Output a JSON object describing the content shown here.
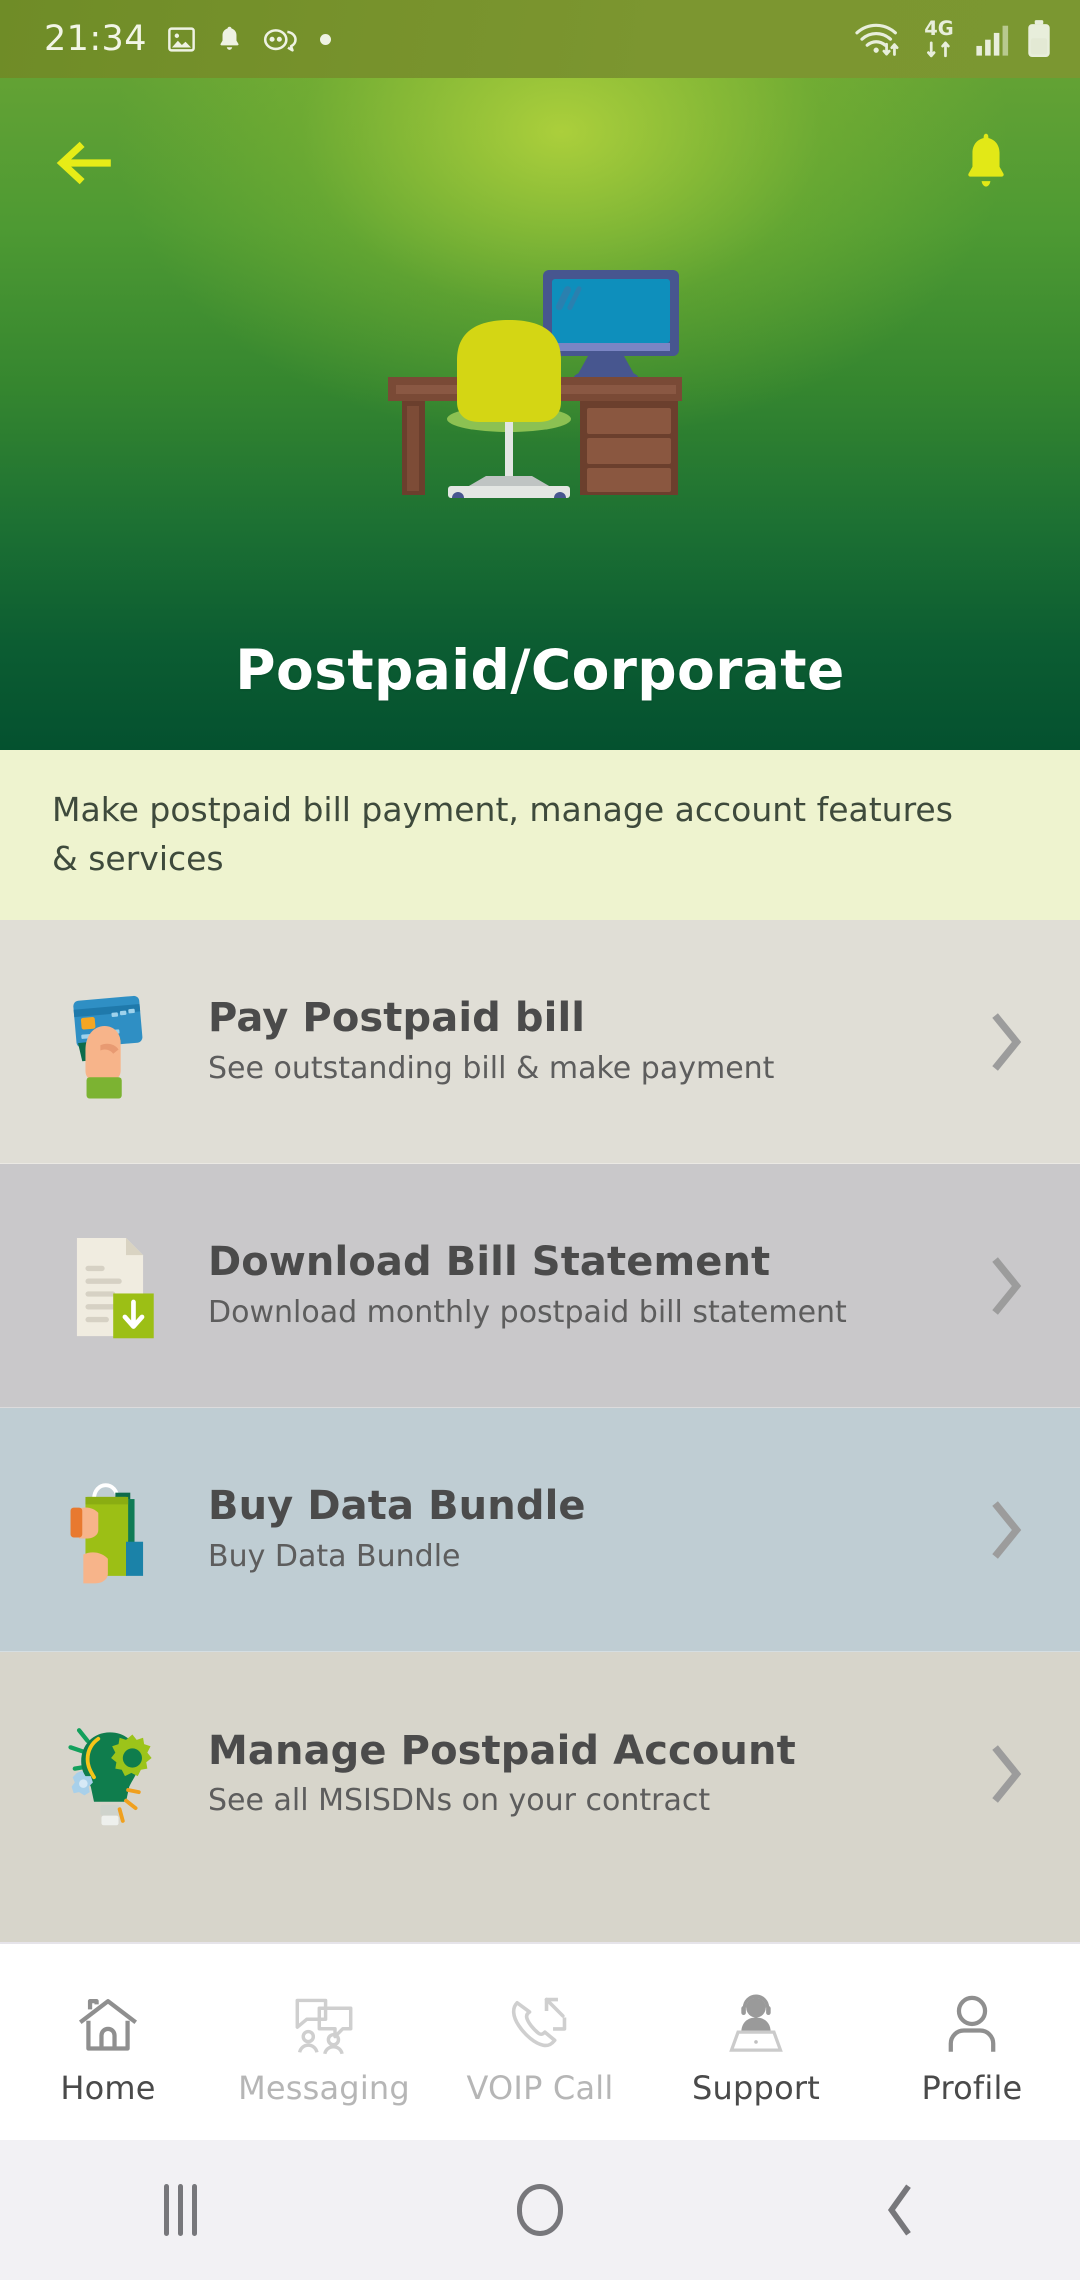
{
  "status_bar": {
    "time": "21:34",
    "left_icons": [
      "image-icon",
      "bell-icon",
      "chat-icon",
      "dot-icon"
    ],
    "right_icons": [
      "wifi-icon",
      "4g-icon",
      "signal-icon",
      "battery-icon"
    ],
    "network_label": "4G",
    "background_color": "#7a9430"
  },
  "hero": {
    "back_icon": "back-arrow-icon",
    "notification_icon": "bell-icon",
    "illustration": "office-desk-illustration",
    "title": "Postpaid/Corporate",
    "accent_color": "#e3e812",
    "gradient_top": "#63a234",
    "gradient_bottom": "#04512f"
  },
  "subtitle_band": {
    "text": "Make postpaid bill payment, manage account features & services",
    "background_color": "#eef3cf"
  },
  "menu": {
    "items": [
      {
        "title": "Pay Postpaid bill",
        "subtitle": "See outstanding bill & make payment",
        "icon": "credit-card-hand-icon",
        "background_color": "#e0ded6",
        "chevron": "chevron-right-icon"
      },
      {
        "title": "Download Bill Statement",
        "subtitle": "Download monthly postpaid bill statement",
        "icon": "document-download-icon",
        "background_color": "#c9c8ca",
        "chevron": "chevron-right-icon"
      },
      {
        "title": "Buy Data Bundle",
        "subtitle": "Buy Data Bundle",
        "icon": "shopping-bags-icon",
        "background_color": "#bfcdd3",
        "chevron": "chevron-right-icon"
      },
      {
        "title": "Manage Postpaid Account",
        "subtitle": "See all MSISDNs on your contract",
        "icon": "lightbulb-gear-icon",
        "background_color": "#d7d5cb",
        "chevron": "chevron-right-icon"
      }
    ]
  },
  "bottom_nav": {
    "items": [
      {
        "label": "Home",
        "icon": "home-icon",
        "state": "dark"
      },
      {
        "label": "Messaging",
        "icon": "messaging-icon",
        "state": "dim"
      },
      {
        "label": "VOIP Call",
        "icon": "voip-call-icon",
        "state": "dim"
      },
      {
        "label": "Support",
        "icon": "support-agent-icon",
        "state": "dark"
      },
      {
        "label": "Profile",
        "icon": "profile-icon",
        "state": "dark"
      }
    ]
  },
  "system_nav": {
    "recents": "recents-icon",
    "home": "home-circle-icon",
    "back": "back-chevron-icon",
    "background_color": "#f2f1f4"
  }
}
